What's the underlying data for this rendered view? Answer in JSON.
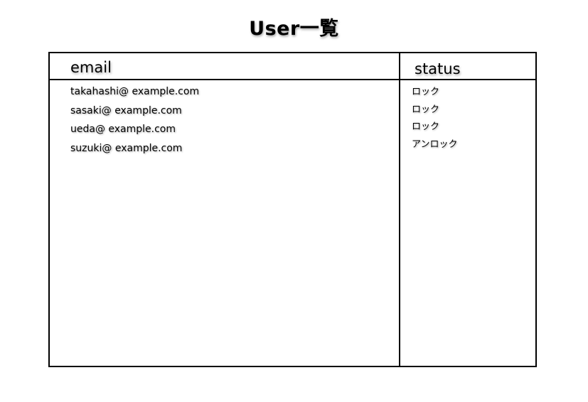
{
  "page": {
    "title": "User一覧"
  },
  "table": {
    "columns": {
      "email": "email",
      "status": "status"
    },
    "rows": [
      {
        "email": "takahashi@ example.com",
        "status": "ロック"
      },
      {
        "email": "sasaki@ example.com",
        "status": "ロック"
      },
      {
        "email": "ueda@ example.com",
        "status": "ロック"
      },
      {
        "email": "suzuki@ example.com",
        "status": "アンロック"
      }
    ]
  }
}
